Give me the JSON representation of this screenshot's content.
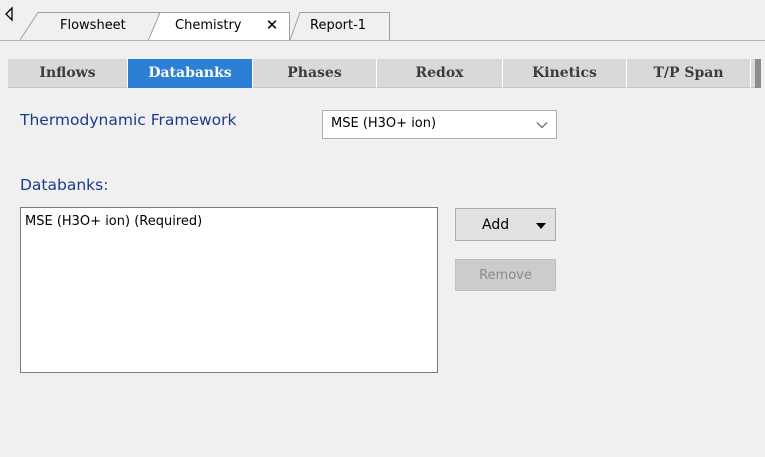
{
  "doc_tabs": [
    {
      "label": "Flowsheet",
      "active": false
    },
    {
      "label": "Chemistry",
      "active": true,
      "closable": true
    },
    {
      "label": "Report-1",
      "active": false
    }
  ],
  "sub_tabs": [
    {
      "label": "Inflows",
      "active": false
    },
    {
      "label": "Databanks",
      "active": true
    },
    {
      "label": "Phases",
      "active": false
    },
    {
      "label": "Redox",
      "active": false
    },
    {
      "label": "Kinetics",
      "active": false
    },
    {
      "label": "T/P Span",
      "active": false
    }
  ],
  "framework": {
    "label": "Thermodynamic Framework",
    "selected": "MSE (H3O+ ion)"
  },
  "databanks": {
    "label": "Databanks:",
    "items": [
      "MSE (H3O+ ion) (Required)"
    ]
  },
  "buttons": {
    "add_label": "Add",
    "remove_label": "Remove"
  },
  "icons": {
    "scroll_left": "triangle-left-icon",
    "close": "close-icon",
    "dropdown": "chevron-down-icon",
    "add_menu": "caret-down-icon"
  },
  "colors": {
    "active_tab": "#2b7fd4",
    "label_text": "#1a3b8c",
    "background": "#f0f0f0"
  }
}
